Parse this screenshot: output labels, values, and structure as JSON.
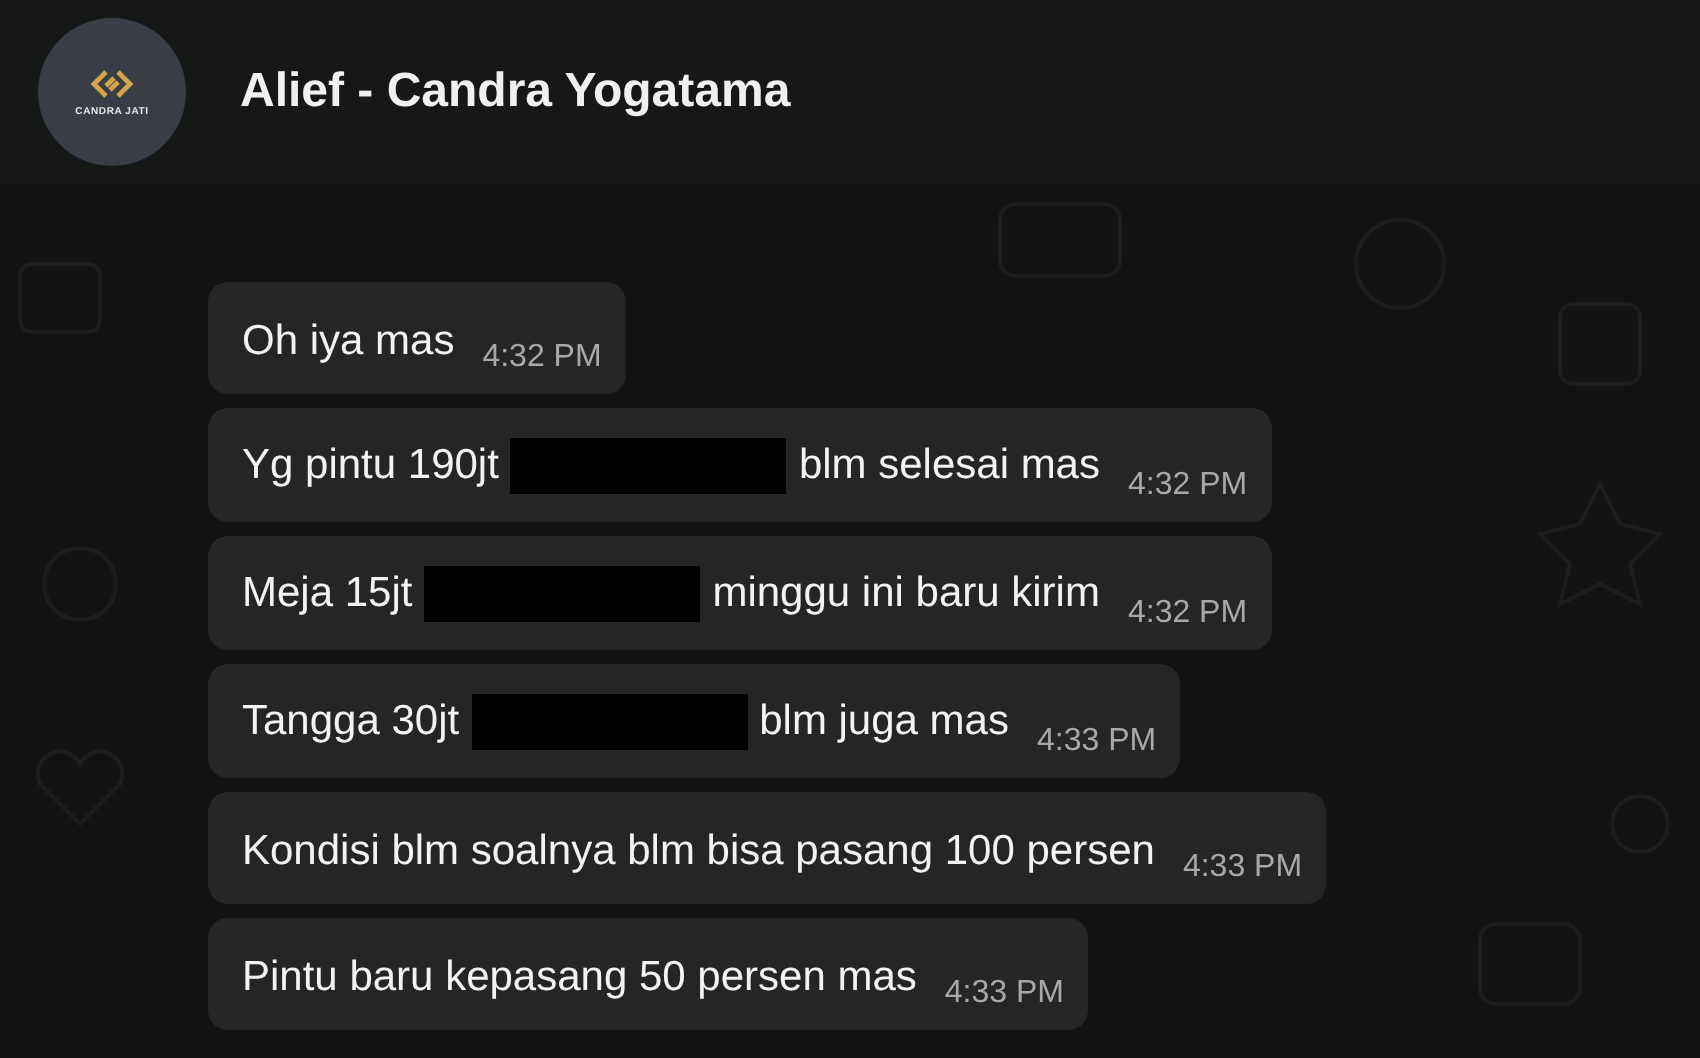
{
  "header": {
    "avatar_label": "CANDRA JATI",
    "title": "Alief - Candra Yogatama"
  },
  "messages": [
    {
      "parts": [
        {
          "kind": "text",
          "text": "Oh iya mas"
        }
      ],
      "time": "4:32 PM"
    },
    {
      "parts": [
        {
          "kind": "text",
          "text": "Yg pintu 190jt"
        },
        {
          "kind": "redacted"
        },
        {
          "kind": "text",
          "text": "blm selesai mas"
        }
      ],
      "time": "4:32 PM"
    },
    {
      "parts": [
        {
          "kind": "text",
          "text": "Meja 15jt"
        },
        {
          "kind": "redacted"
        },
        {
          "kind": "text",
          "text": "minggu ini baru kirim"
        }
      ],
      "time": "4:32 PM"
    },
    {
      "parts": [
        {
          "kind": "text",
          "text": "Tangga 30jt"
        },
        {
          "kind": "redacted"
        },
        {
          "kind": "text",
          "text": "blm juga mas"
        }
      ],
      "time": "4:33 PM"
    },
    {
      "parts": [
        {
          "kind": "text",
          "text": "Kondisi blm soalnya blm bisa pasang 100 persen"
        }
      ],
      "time": "4:33 PM"
    },
    {
      "parts": [
        {
          "kind": "text",
          "text": "Pintu baru kepasang 50 persen mas"
        }
      ],
      "time": "4:33 PM"
    }
  ]
}
